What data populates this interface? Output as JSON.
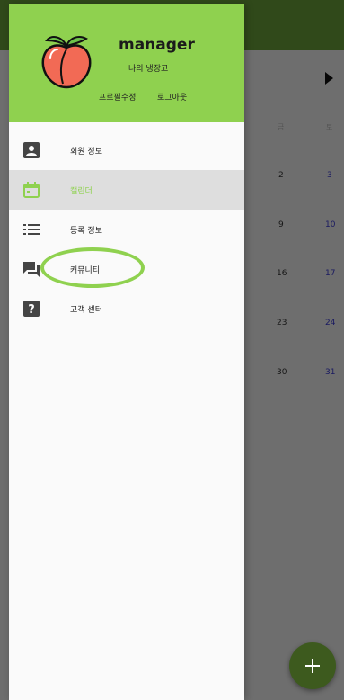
{
  "drawer": {
    "username": "manager",
    "subtitle": "나의 냉장고",
    "edit_profile": "프로필수정",
    "logout": "로그아웃",
    "items": [
      {
        "label": "회원 정보",
        "icon": "account-box-icon",
        "selected": false
      },
      {
        "label": "캘린더",
        "icon": "calendar-icon",
        "selected": true
      },
      {
        "label": "등록 정보",
        "icon": "list-icon",
        "selected": false
      },
      {
        "label": "커뮤니티",
        "icon": "forum-icon",
        "selected": false
      },
      {
        "label": "고객 센터",
        "icon": "help-icon",
        "selected": false
      }
    ]
  },
  "calendar": {
    "weekdays": [
      "금",
      "토"
    ],
    "fridays": [
      "2",
      "9",
      "16",
      "23",
      "30"
    ],
    "saturdays": [
      "3",
      "10",
      "17",
      "24",
      "31"
    ]
  },
  "colors": {
    "drawer_header": "#8fd14f",
    "app_bar": "#6aa23a",
    "fab": "#3d5a1e",
    "accent": "#8fd14f"
  },
  "fab": {
    "icon": "plus-icon"
  }
}
